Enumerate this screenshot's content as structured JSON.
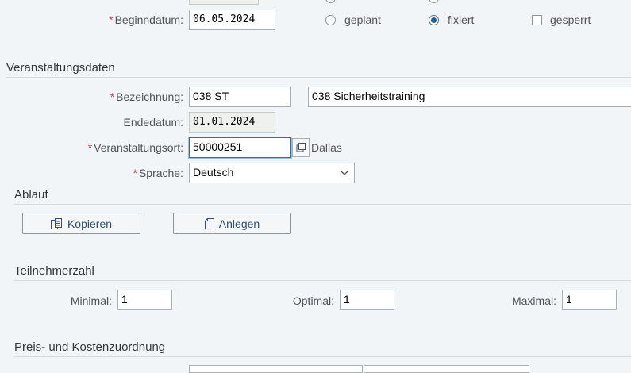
{
  "header": {
    "begin_label": "Beginndatum:",
    "begin_value": "06.05.2024",
    "status_options": [
      {
        "label": "geplant",
        "selected": false
      },
      {
        "label": "fixiert",
        "selected": true
      }
    ],
    "locked_label": "gesperrt",
    "locked_checked": false
  },
  "event_data": {
    "section_title": "Veranstaltungsdaten",
    "name_label": "Bezeichnung:",
    "name_short": "038 ST",
    "name_long": "038 Sicherheitstraining",
    "end_label": "Endedatum:",
    "end_value": "01.01.2024",
    "location_label": "Veranstaltungsort:",
    "location_value": "50000251",
    "location_text": "Dallas",
    "language_label": "Sprache:",
    "language_value": "Deutsch"
  },
  "process": {
    "section_title": "Ablauf",
    "copy_label": "Kopieren",
    "create_label": "Anlegen"
  },
  "participants": {
    "section_title": "Teilnehmerzahl",
    "min_label": "Minimal:",
    "min_value": "1",
    "opt_label": "Optimal:",
    "opt_value": "1",
    "max_label": "Maximal:",
    "max_value": "1"
  },
  "pricing": {
    "section_title": "Preis- und Kostenzuordnung"
  },
  "colors": {
    "background": "#f2f5f8",
    "required": "#c14646",
    "accent": "#1b5b9c"
  }
}
